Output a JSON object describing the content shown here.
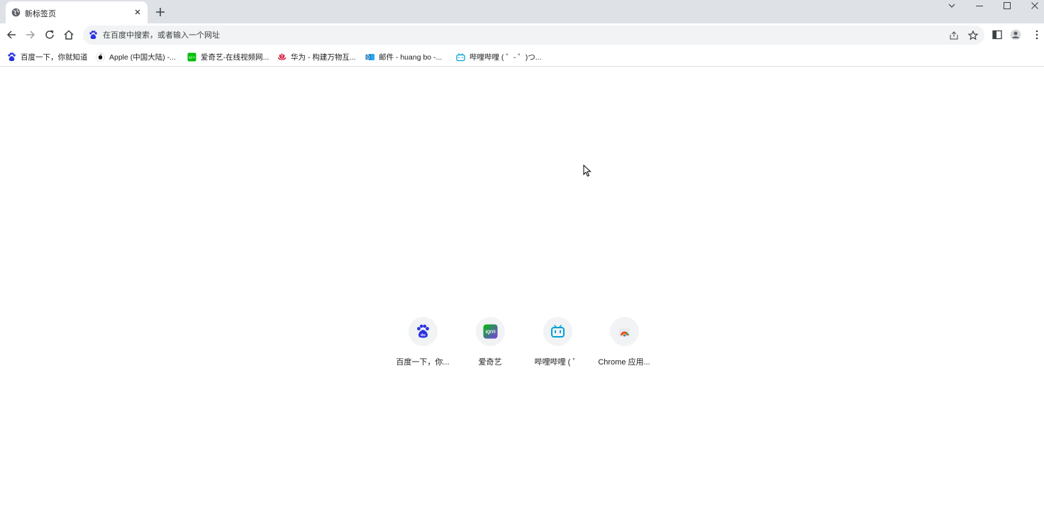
{
  "tab": {
    "title": "新标签页",
    "favicon": "globe-icon"
  },
  "window_controls": [
    "tab-search-icon",
    "minimize-icon",
    "maximize-icon",
    "close-icon"
  ],
  "omnibox": {
    "placeholder": "在百度中搜索，或者输入一个网址",
    "search_engine_icon": "baidu-paw-icon"
  },
  "bookmarks": [
    {
      "label": "百度一下，你就知道",
      "icon": "baidu-paw-icon"
    },
    {
      "label": "Apple (中国大陆) -...",
      "icon": "apple-icon"
    },
    {
      "label": "爱奇艺-在线视频网...",
      "icon": "iqiyi-icon"
    },
    {
      "label": "华为 - 构建万物互...",
      "icon": "huawei-icon"
    },
    {
      "label": "邮件 - huang bo -...",
      "icon": "outlook-icon"
    },
    {
      "label": "哔哩哔哩 ( ゜- ゜)つ...",
      "icon": "bilibili-icon"
    }
  ],
  "shortcuts": [
    {
      "label": "百度一下，你...",
      "icon": "baidu-paw-icon"
    },
    {
      "label": "爱奇艺",
      "icon": "iqiyi-icon"
    },
    {
      "label": "哔哩哔哩 ( ゜",
      "icon": "bilibili-icon"
    },
    {
      "label": "Chrome 应用...",
      "icon": "chrome-web-store-icon"
    }
  ],
  "colors": {
    "tabstrip": "#dee1e6",
    "omnibox": "#f1f3f4",
    "baidu": "#2932e1",
    "iqiyi": "#00be06",
    "bilibili": "#00a1d6",
    "huawei": "#cf0a2c",
    "outlook": "#0f6cbd"
  }
}
